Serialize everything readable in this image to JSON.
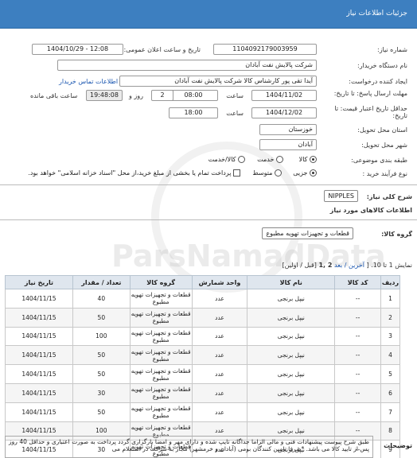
{
  "header": {
    "title": "جزئیات اطلاعات نیاز"
  },
  "form": {
    "need_number_label": "شماره نیاز:",
    "need_number": "1104092179003959",
    "announce_label": "تاریخ و ساعت اعلان عمومی:",
    "announce_value": "1404/10/29 - 12:08",
    "buyer_label": "نام دستگاه خریدار:",
    "buyer_value": "شرکت پالایش نفت آبادان",
    "creator_label": "ایجاد کننده درخواست:",
    "creator_value": "آیدا تقی پور کارشناس کالا شرکت پالایش نفت آبادان",
    "contact_link": "اطلاعات تماس خریدار",
    "deadline_label": "مهلت ارسال پاسخ: تا تاریخ:",
    "deadline_date": "1404/11/02",
    "time_label": "ساعت",
    "deadline_time": "08:00",
    "remaining_days": "2",
    "day_and_label": "روز و",
    "remaining_time": "19:48:08",
    "remaining_label": "ساعت باقی مانده",
    "validity_label": "حداقل تاریخ اعتبار قیمت: تا تاریخ:",
    "validity_date": "1404/12/02",
    "validity_time_label": "ساعت",
    "validity_time": "18:00",
    "province_label": "استان محل تحویل:",
    "province_value": "خوزستان",
    "city_label": "شهر محل تحویل:",
    "city_value": "آبادان",
    "category_label": "طبقه بندی موضوعی:",
    "category_options": [
      "کالا",
      "خدمت",
      "کالا/خدمت"
    ],
    "category_selected": "کالا",
    "process_label": "نوع فرآیند خرید :",
    "process_options": [
      "جزیی",
      "متوسط"
    ],
    "process_selected": "جزیی",
    "payment_text": "پرداخت تمام یا بخشی از مبلغ خرید،از محل \"اسناد خزانه اسلامی\" خواهد بود."
  },
  "need_summary": {
    "label": "شرح کلی نیاز:",
    "value": "NIPPLES"
  },
  "goods_section": {
    "title": "اطلاعات کالاهای مورد نیاز",
    "group_label": "گروه کالا:",
    "group_value": "قطعات و تجهیزات تهویه مطبوع",
    "pagination_prefix": "نمایش 1 تا 10. [",
    "pagination_links": "آخرین / بعد",
    "pagination_pages": "2 ,1",
    "pagination_suffix": "[قبل / اولین]"
  },
  "table": {
    "columns": [
      "ردیف",
      "کد کالا",
      "نام کالا",
      "واحد شمارش",
      "گروه کالا",
      "تعداد / مقدار",
      "تاریخ نیاز"
    ],
    "rows": [
      [
        "1",
        "--",
        "نیپل برنجی",
        "عدد",
        "قطعات و تجهیزات تهویه مطبوع",
        "40",
        "1404/11/15"
      ],
      [
        "2",
        "--",
        "نیپل برنجی",
        "عدد",
        "قطعات و تجهیزات تهویه مطبوع",
        "50",
        "1404/11/15"
      ],
      [
        "3",
        "--",
        "نیپل برنجی",
        "عدد",
        "قطعات و تجهیزات تهویه مطبوع",
        "100",
        "1404/11/15"
      ],
      [
        "4",
        "--",
        "نیپل برنجی",
        "عدد",
        "قطعات و تجهیزات تهویه مطبوع",
        "50",
        "1404/11/15"
      ],
      [
        "5",
        "--",
        "نیپل برنجی",
        "عدد",
        "قطعات و تجهیزات تهویه مطبوع",
        "50",
        "1404/11/15"
      ],
      [
        "6",
        "--",
        "نیپل برنجی",
        "عدد",
        "قطعات و تجهیزات تهویه مطبوع",
        "30",
        "1404/11/15"
      ],
      [
        "7",
        "--",
        "نیپل برنجی",
        "عدد",
        "قطعات و تجهیزات تهویه مطبوع",
        "50",
        "1404/11/15"
      ],
      [
        "8",
        "--",
        "نیپل برنجی",
        "عدد",
        "قطعات و تجهیزات تهویه مطبوع",
        "100",
        "1404/11/15"
      ],
      [
        "9",
        "--",
        "نیپل برنجی",
        "عدد",
        "قطعات و تجهیزات تهویه مطبوع",
        "30",
        "1404/11/15"
      ]
    ]
  },
  "notes": {
    "label": "توضیحات",
    "text": "طبق شرح پیوست پیشنهادات فنی و مالی الزاما جداگانه تایپ شده و دارای مهر و امضا بارگزاری گردد پرداخت به صورت اعتباری و حداقل 40 روز پس از تایید کالا می باشد. *صرفا تامین کنندگان بومی (آبادان و خرمشهر) مجاز به شرکت در استعلام می"
  },
  "watermark": {
    "text": "ParsNamadData"
  }
}
